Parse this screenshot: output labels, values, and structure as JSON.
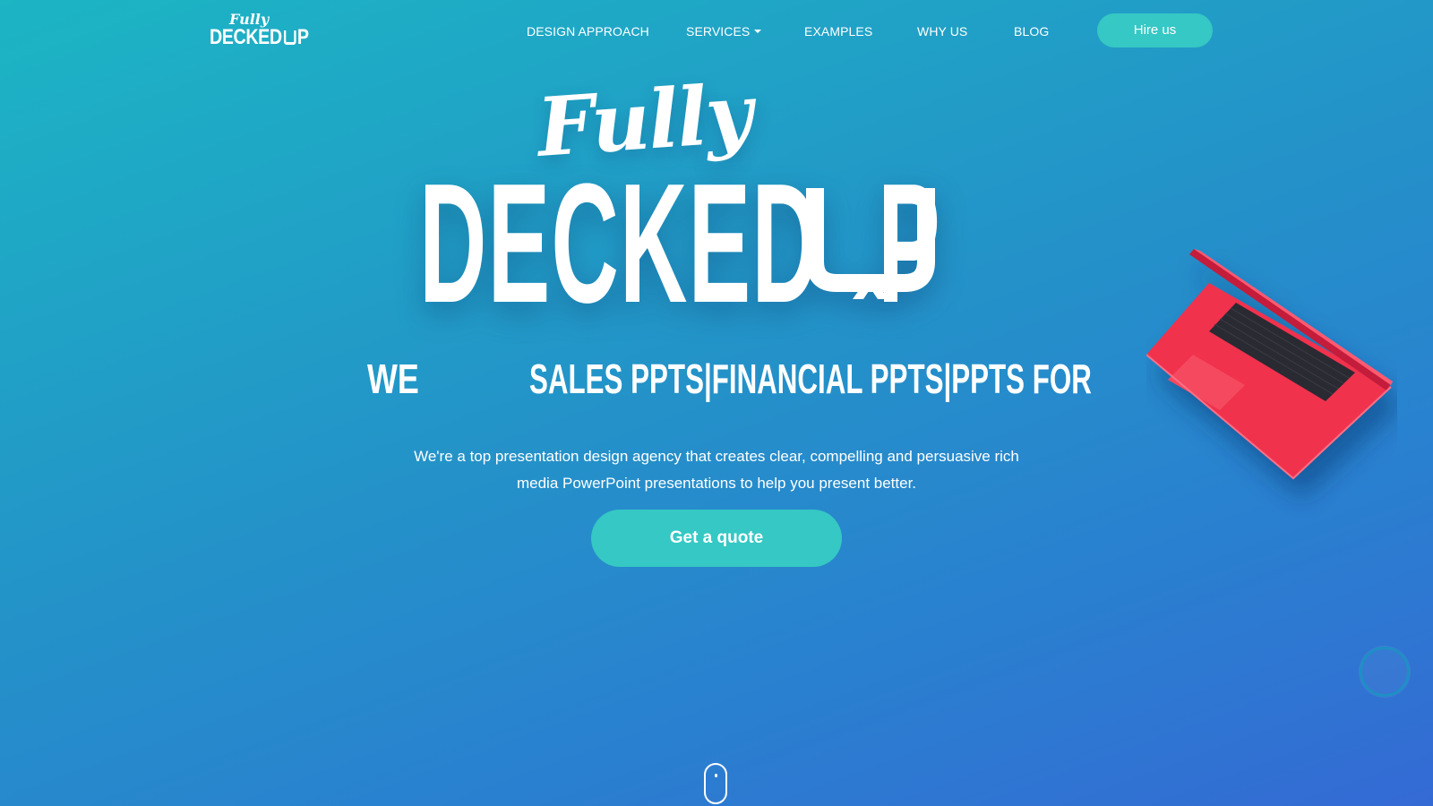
{
  "brand": {
    "script": "Fully",
    "word1": "DECKED",
    "word2": "P"
  },
  "nav": {
    "items": [
      {
        "label": "DESIGN APPROACH"
      },
      {
        "label": "SERVICES"
      },
      {
        "label": "EXAMPLES"
      },
      {
        "label": "WHY US"
      },
      {
        "label": "BLOG"
      }
    ],
    "services_has_dropdown": true,
    "hire_label": "Hire us"
  },
  "hero": {
    "script": "Fully",
    "word1": "DECKED",
    "word2": "P",
    "tag_prefix": "WE",
    "tag_rotator": "SALES PPTS|FINANCIAL PPTS|PPTS FOR",
    "description": "We're a top presentation design agency that creates clear, compelling and persuasive rich media PowerPoint presentations to help you present better.",
    "cta_label": "Get a quote"
  },
  "colors": {
    "gradient_start": "#1cb5c4",
    "gradient_end": "#346ad4",
    "accent": "#35c8c4",
    "laptop": "#f0304e",
    "text": "#ffffff"
  },
  "icons": {
    "laptop": "laptop-illustration",
    "chat": "chat-bubble-icon",
    "scroll": "scroll-mouse-icon",
    "services_caret": "caret-down-icon"
  }
}
